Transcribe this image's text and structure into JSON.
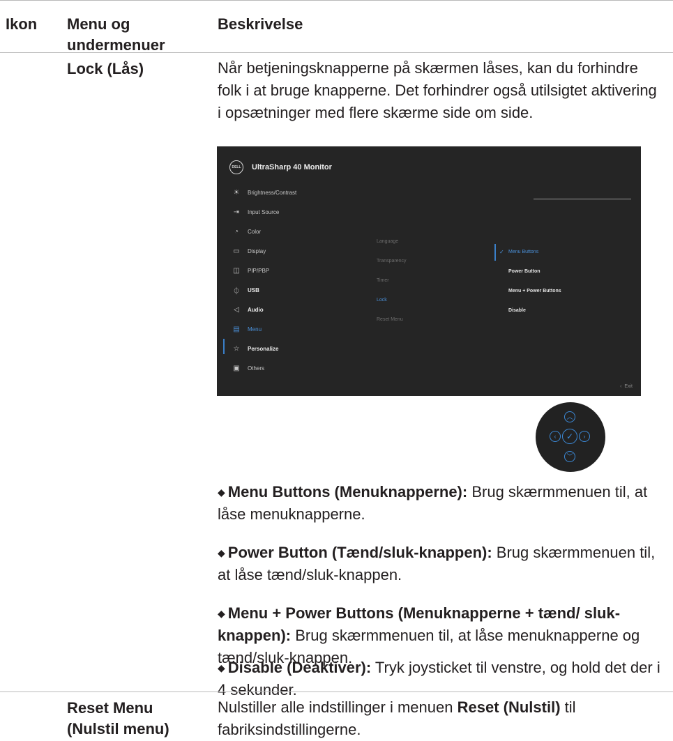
{
  "header": {
    "col_icon": "Ikon",
    "col_menu_line1": "Menu og",
    "col_menu_line2": "undermenuer",
    "col_desc": "Beskrivelse"
  },
  "lock_row": {
    "name": "Lock (Lås)",
    "description": "Når betjeningsknapperne på skærmen låses, kan du forhindre folk i at bruge knapperne. Det forhindrer også utilsigtet aktivering i opsætninger med flere skærme side om side."
  },
  "osd": {
    "logo_text": "DELL",
    "title": "UltraSharp 40 Monitor",
    "menu_items": [
      {
        "label": "Brightness/Contrast",
        "icon": "☀"
      },
      {
        "label": "Input Source",
        "icon": "⇥"
      },
      {
        "label": "Color",
        "icon": "◔"
      },
      {
        "label": "Display",
        "icon": "▭"
      },
      {
        "label": "PIP/PBP",
        "icon": "◫"
      },
      {
        "label": "USB",
        "icon": "⏀"
      },
      {
        "label": "Audio",
        "icon": "◁"
      },
      {
        "label": "Menu",
        "icon": "▤"
      },
      {
        "label": "Personalize",
        "icon": "☆"
      },
      {
        "label": "Others",
        "icon": "▣"
      }
    ],
    "sub_items": [
      "Language",
      "Transparency",
      "Timer",
      "Lock",
      "Reset Menu"
    ],
    "options": [
      "Menu Buttons",
      "Power Button",
      "Menu + Power Buttons",
      "Disable"
    ],
    "exit_label": "Exit",
    "accent_color": "#4a90d9"
  },
  "joystick": {
    "up": "︿",
    "down": "﹀",
    "left": "‹",
    "right": "›",
    "center": "✓"
  },
  "bullets": [
    {
      "bold": "Menu Buttons (Menuknapperne):",
      "text": " Brug skærmmenuen til, at låse menuknapperne."
    },
    {
      "bold": "Power Button (Tænd/sluk-knappen):",
      "text": " Brug skærmmenuen til, at låse tænd/sluk-knappen."
    },
    {
      "bold": "Menu + Power Buttons (Menuknapperne + tænd/ sluk-knappen):",
      "text": " Brug skærmmenuen til, at låse menuknapperne og tænd/sluk-knappen."
    },
    {
      "bold": "Disable (Deaktiver):",
      "text": " Tryk joysticket til venstre, og hold det der i 4 sekunder."
    }
  ],
  "reset_row": {
    "name_line1": "Reset Menu",
    "name_line2": "(Nulstil menu)",
    "desc_before": "Nulstiller alle indstillinger i menuen ",
    "desc_bold": "Reset (Nulstil)",
    "desc_after": " til fabriksindstillingerne."
  }
}
